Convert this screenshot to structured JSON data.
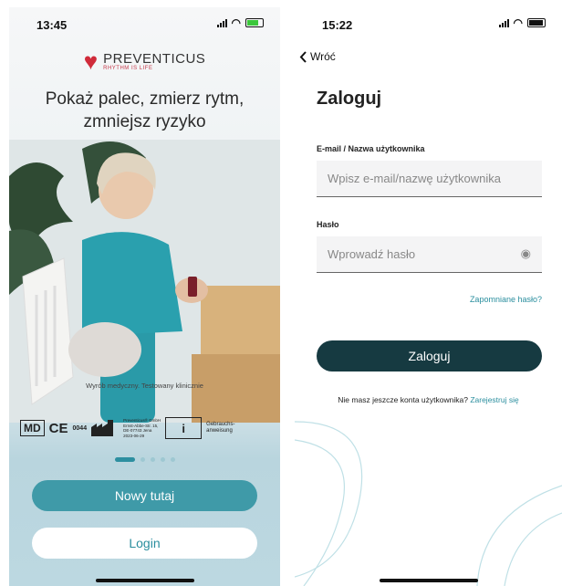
{
  "left_screen": {
    "status": {
      "time": "13:45"
    },
    "logo": {
      "brand": "PREVENTICUS",
      "tagline": "RHYTHM IS LIFE"
    },
    "headline": "Pokaż palec, zmierz rytm, zmniejsz ryzyko",
    "caption": "Wyrób medyczny. Testowany klinicznie",
    "badges": {
      "md": "MD",
      "ce": "CE",
      "ce_number": "0044",
      "manufacturer_lines": [
        "Preventicus® GmbH",
        "Ernst-Abbe-Str. 15,",
        "DE-07743 Jena",
        "2023-06-29"
      ],
      "ifu_icon": "i",
      "ifu_text_1": "Gebrauchs-",
      "ifu_text_2": "anweisung"
    },
    "pagination": {
      "total": 5,
      "active": 1
    },
    "buttons": {
      "primary": "Nowy tutaj",
      "secondary": "Login"
    },
    "colors": {
      "primary_button": "#3f9aa8",
      "brand_red": "#d02b3a"
    }
  },
  "right_screen": {
    "status": {
      "time": "15:22"
    },
    "back_label": "Wróć",
    "title": "Zaloguj",
    "email_label": "E-mail / Nazwa użytkownika",
    "email_placeholder": "Wpisz e-mail/nazwę użytkownika",
    "password_label": "Hasło",
    "password_placeholder": "Wprowadź hasło",
    "forgot": "Zapomniane hasło?",
    "login_button": "Zaloguj",
    "signup_text": "Nie masz jeszcze konta użytkownika?",
    "signup_link": "Zarejestruj się",
    "icons": {
      "back": "chevron-left-icon",
      "password_toggle": "eye-icon"
    },
    "colors": {
      "login_button": "#163a41",
      "link": "#2a8e9e"
    }
  }
}
